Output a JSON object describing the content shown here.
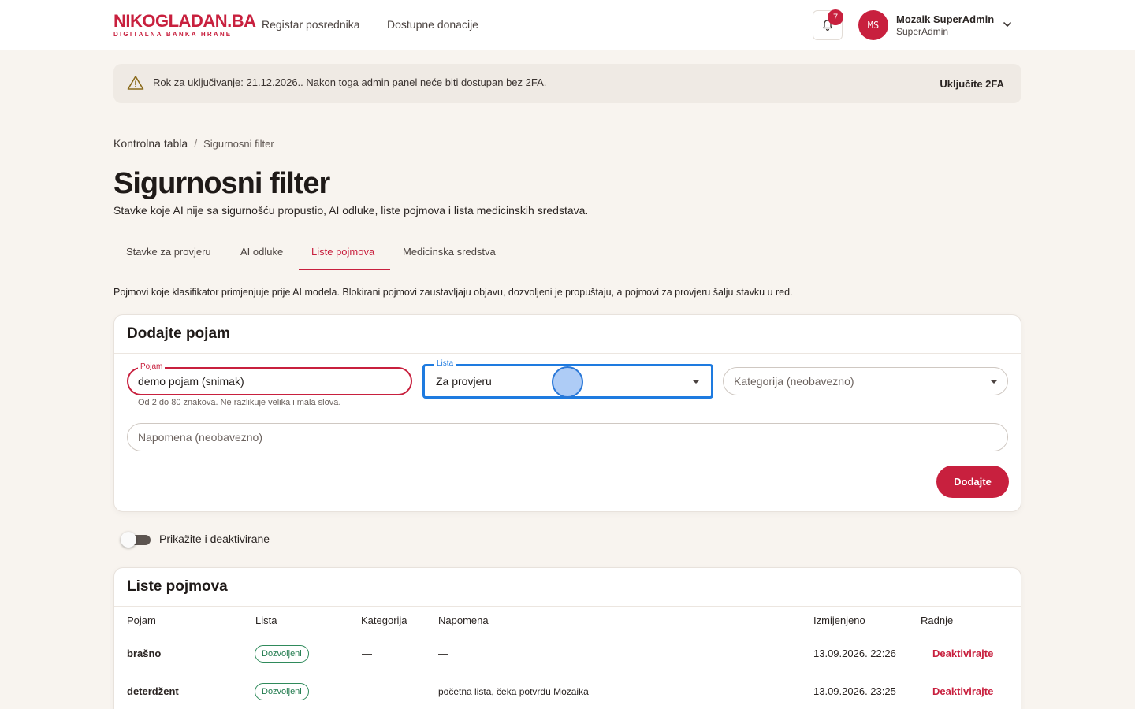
{
  "header": {
    "logo_main": "NIKOGLADAN.BA",
    "logo_sub": "DIGITALNA BANKA HRANE",
    "nav": [
      "Registar posrednika",
      "Dostupne donacije"
    ],
    "notifications_count": "7",
    "user": {
      "initials": "MS",
      "name": "Mozaik SuperAdmin",
      "role": "SuperAdmin"
    }
  },
  "banner": {
    "text": "Rok za uključivanje: 21.12.2026.. Nakon toga admin panel neće biti dostupan bez 2FA.",
    "action": "Uključite 2FA"
  },
  "breadcrumb": {
    "home": "Kontrolna tabla",
    "separator": "/",
    "current": "Sigurnosni filter"
  },
  "page": {
    "title": "Sigurnosni filter",
    "subtitle": "Stavke koje AI nije sa sigurnošću propustio, AI odluke, liste pojmova i lista medicinskih sredstava."
  },
  "tabs": [
    {
      "label": "Stavke za provjeru"
    },
    {
      "label": "AI odluke"
    },
    {
      "label": "Liste pojmova",
      "active": true
    },
    {
      "label": "Medicinska sredstva"
    }
  ],
  "info_text": "Pojmovi koje klasifikator primjenjuje prije AI modela. Blokirani pojmovi zaustavljaju objavu, dozvoljeni je propuštaju, a pojmovi za provjeru šalju stavku u red.",
  "add_form": {
    "title": "Dodajte pojam",
    "term": {
      "label": "Pojam",
      "value": "demo pojam (snimak)",
      "helper": "Od 2 do 80 znakova. Ne razlikuje velika i mala slova."
    },
    "list": {
      "label": "Lista",
      "value": "Za provjeru"
    },
    "category": {
      "placeholder": "Kategorija (neobavezno)"
    },
    "note": {
      "placeholder": "Napomena (neobavezno)"
    },
    "submit": "Dodajte"
  },
  "toggle": {
    "label": "Prikažite i deaktivirane",
    "checked": false
  },
  "table": {
    "title": "Liste pojmova",
    "columns": [
      "Pojam",
      "Lista",
      "Kategorija",
      "Napomena",
      "Izmijenjeno",
      "Radnje"
    ],
    "rows": [
      {
        "term": "brašno",
        "list": "Dozvoljeni",
        "category": "—",
        "note": "—",
        "modified": "13.09.2026. 22:26",
        "action": "Deaktivirajte"
      },
      {
        "term": "deterdžent",
        "list": "Dozvoljeni",
        "category": "—",
        "note": "početna lista, čeka potvrdu Mozaika",
        "modified": "13.09.2026. 23:25",
        "action": "Deaktivirajte"
      }
    ]
  },
  "colors": {
    "brand": "#c8203e",
    "focus": "#1e7be0",
    "chip": "#2f8a5b",
    "background": "#f8f4ef"
  }
}
